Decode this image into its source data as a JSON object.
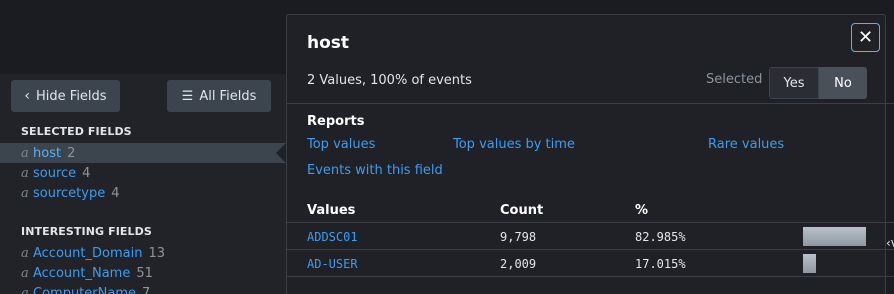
{
  "left": {
    "hide_fields_label": "Hide Fields",
    "all_fields_label": "All Fields",
    "selected_title": "SELECTED FIELDS",
    "selected_fields": [
      {
        "type": "a",
        "name": "host",
        "count": "2"
      },
      {
        "type": "a",
        "name": "source",
        "count": "4"
      },
      {
        "type": "a",
        "name": "sourcetype",
        "count": "4"
      }
    ],
    "interesting_title": "INTERESTING FIELDS",
    "interesting_fields": [
      {
        "type": "a",
        "name": "Account_Domain",
        "count": "13"
      },
      {
        "type": "a",
        "name": "Account_Name",
        "count": "51"
      },
      {
        "type": "a",
        "name": "ComputerName",
        "count": "7"
      }
    ]
  },
  "popover": {
    "title": "host",
    "summary": "2 Values, 100% of events",
    "selected_label": "Selected",
    "toggle_yes": "Yes",
    "toggle_no": "No",
    "reports_title": "Reports",
    "links": {
      "top_values": "Top values",
      "top_values_by_time": "Top values by time",
      "rare_values": "Rare values",
      "events_with_field": "Events with this field"
    },
    "columns": [
      "Values",
      "Count",
      "%"
    ],
    "rows": [
      {
        "value": "ADDSC01",
        "count": "9,798",
        "percent": "82.985%",
        "fraction": 0.82985
      },
      {
        "value": "AD-USER",
        "count": "2,009",
        "percent": "17.015%",
        "fraction": 0.17015
      }
    ]
  },
  "edge_text": "‹v",
  "icons": {
    "chevron": "chevron-left-icon",
    "list": "list-icon",
    "close": "close-icon"
  }
}
